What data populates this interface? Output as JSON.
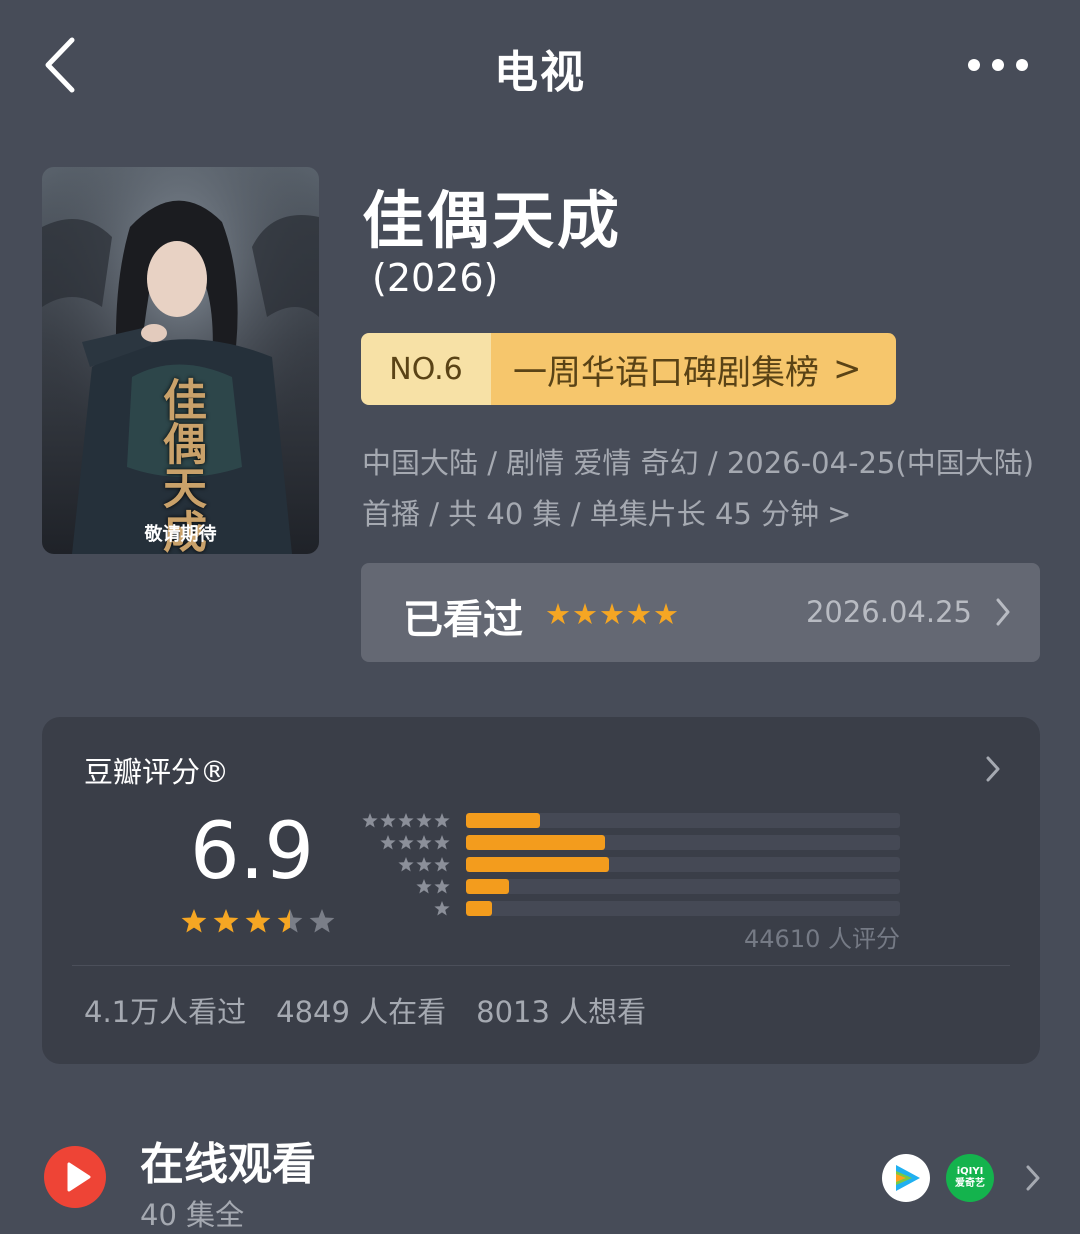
{
  "header": {
    "title": "电视"
  },
  "poster": {
    "title_vertical": "佳偶天成",
    "caption": "敬请期待"
  },
  "show": {
    "title": "佳偶天成",
    "year": "(2026)"
  },
  "rank": {
    "number": "NO.6",
    "list_name": "一周华语口碑剧集榜",
    "chevron": ">"
  },
  "meta": {
    "text": "中国大陆 / 剧情 爱情 奇幻 / 2026-04-25(中国大陆) 首播 / 共 40 集 / 单集片长 45 分钟",
    "chevron": ">"
  },
  "watched": {
    "label": "已看过",
    "stars": "★★★★★",
    "my_rating": 5,
    "date": "2026.04.25"
  },
  "rating": {
    "header": "豆瓣评分®",
    "score": "6.9",
    "star_rating": 3.5,
    "distribution": [
      {
        "stars": 5,
        "fraction": 0.17
      },
      {
        "stars": 4,
        "fraction": 0.32
      },
      {
        "stars": 3,
        "fraction": 0.33
      },
      {
        "stars": 2,
        "fraction": 0.1
      },
      {
        "stars": 1,
        "fraction": 0.06
      }
    ],
    "count_text": "44610 人评分",
    "stats": {
      "watched": "4.1万人看过",
      "watching": "4849 人在看",
      "want": "8013 人想看"
    }
  },
  "online": {
    "title": "在线观看",
    "subtitle": "40 集全",
    "platforms": [
      {
        "name": "tencent-video-icon"
      },
      {
        "name": "iqiyi-icon",
        "logo_top": "iQIYI",
        "logo_bottom": "爱奇艺"
      }
    ]
  },
  "colors": {
    "background": "#474c58",
    "card": "#3a3e48",
    "accent_orange": "#f39c1d",
    "star_orange": "#f5a623",
    "rank_light": "#f7e1a6",
    "rank_gold": "#f6c66c",
    "play_red": "#ee4436"
  }
}
